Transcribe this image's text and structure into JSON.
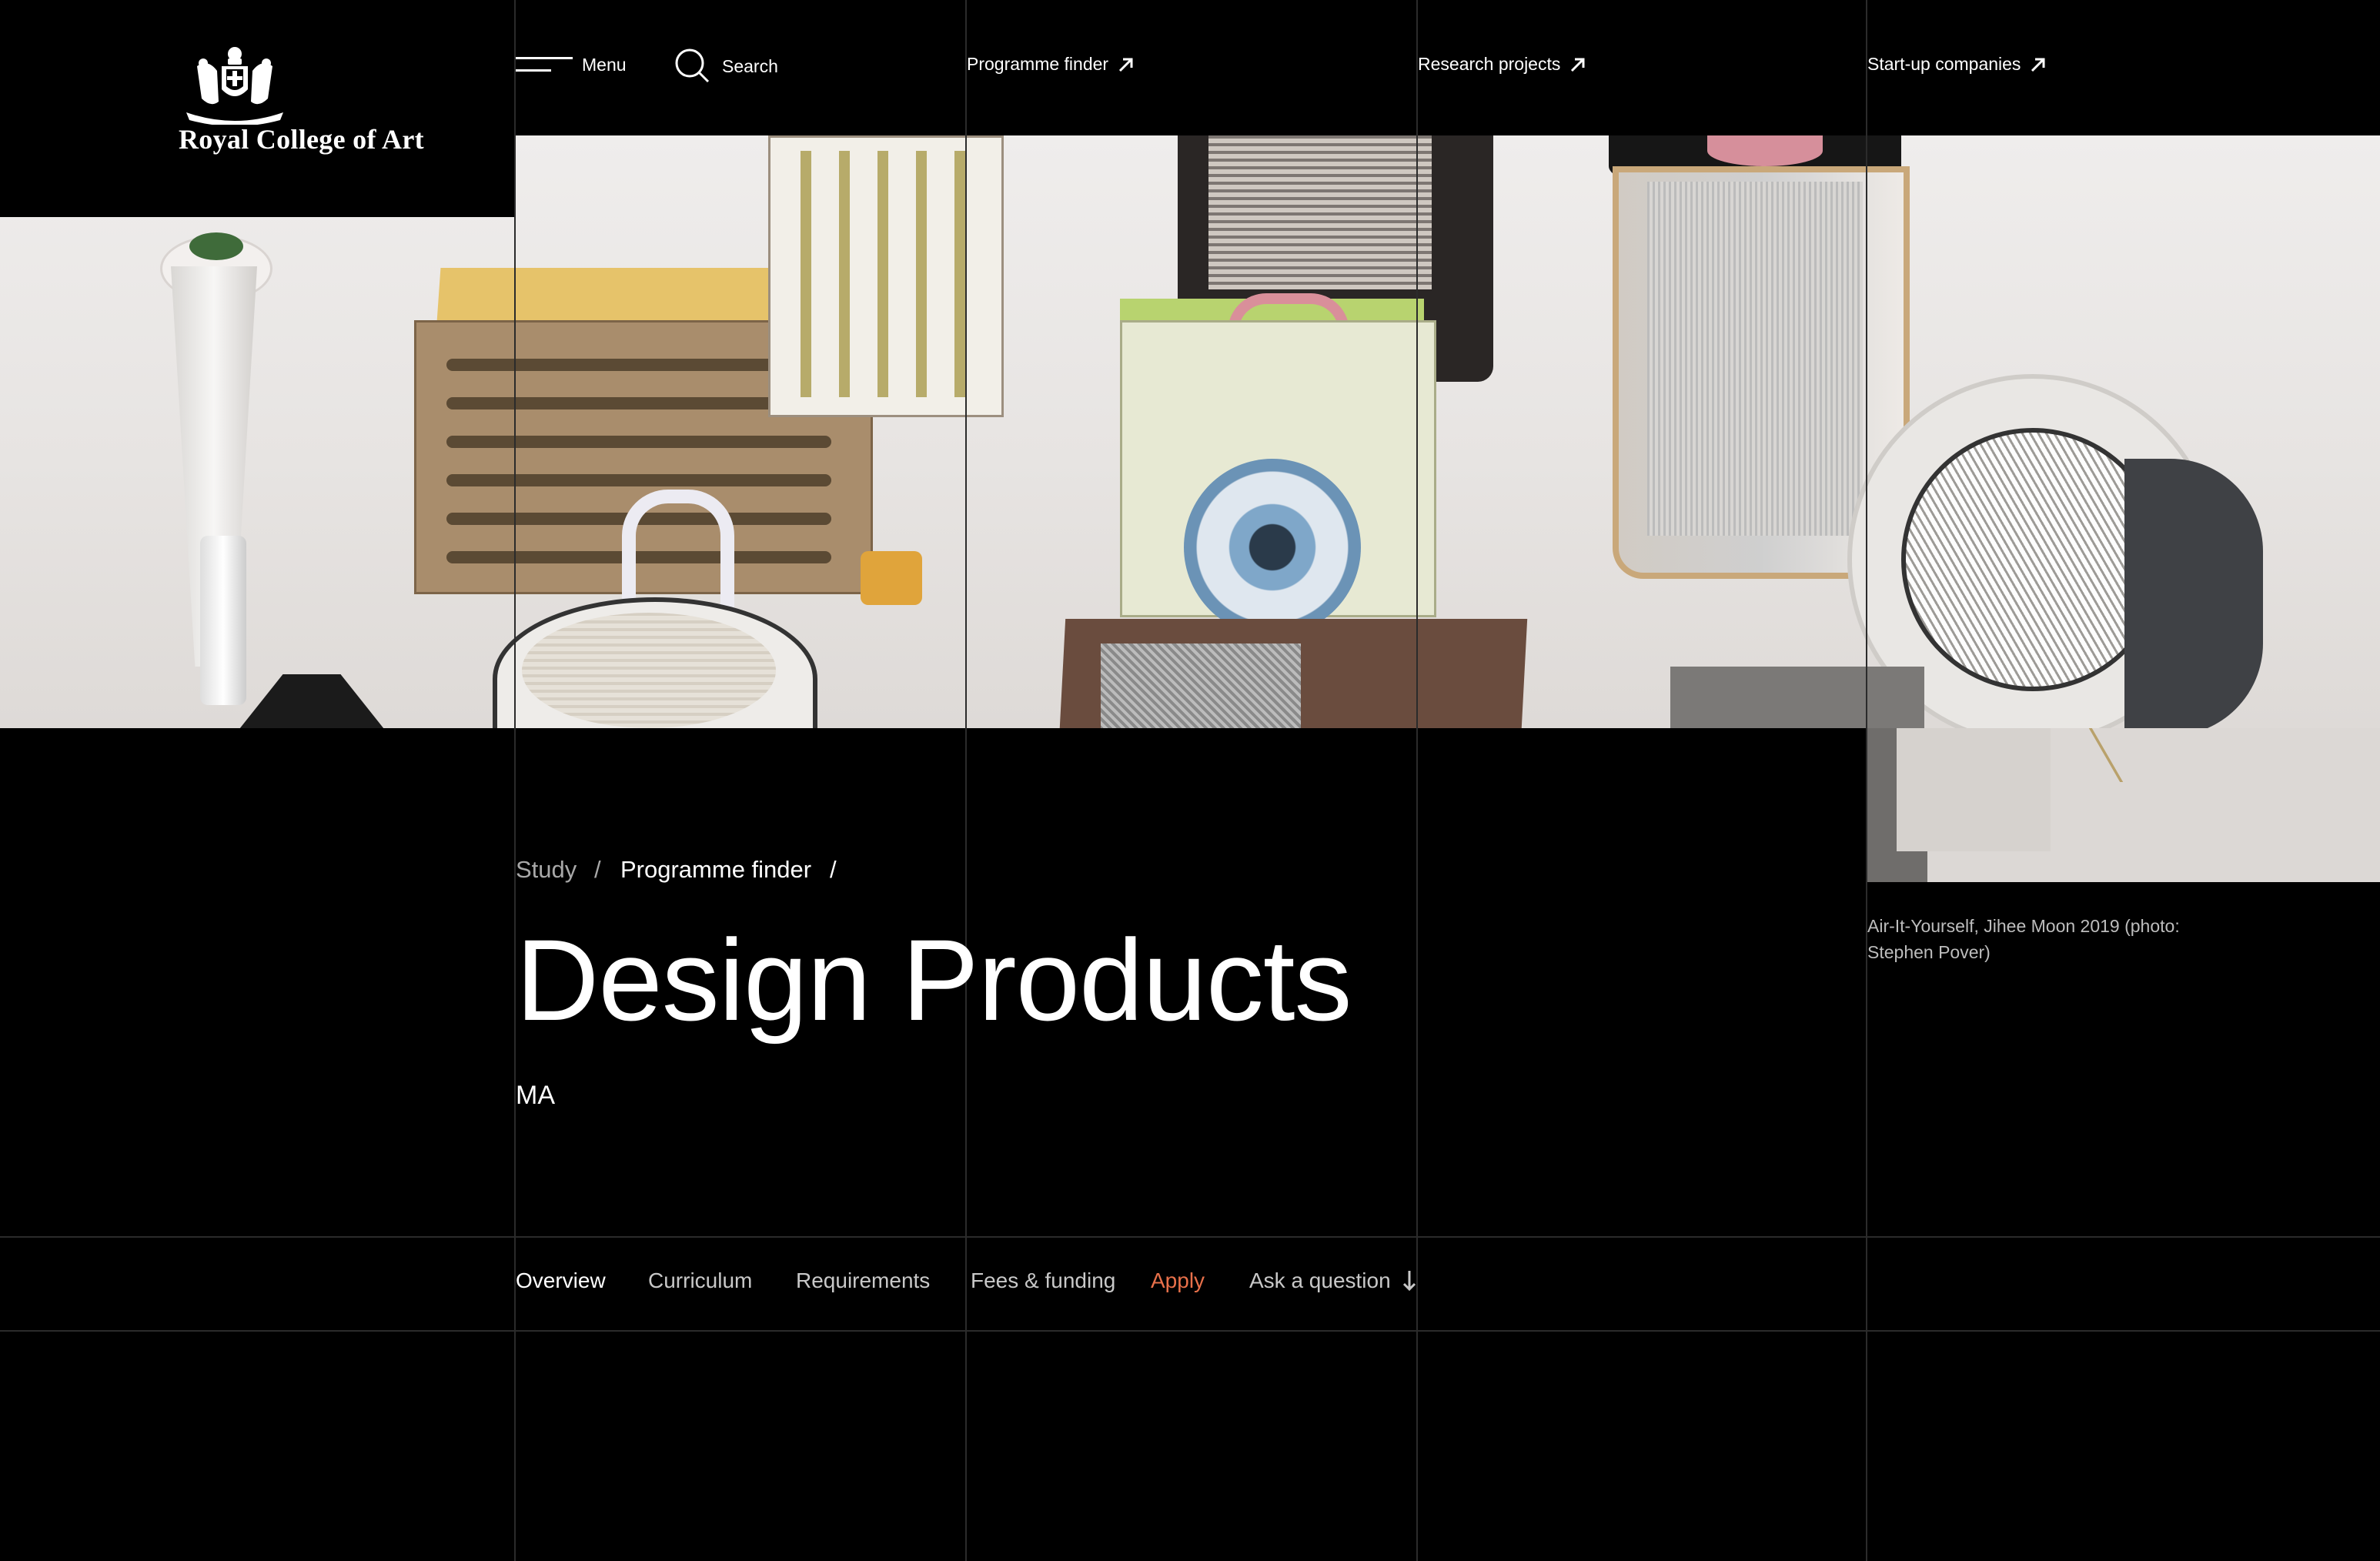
{
  "brand": {
    "name": "Royal College of Art"
  },
  "header": {
    "menu_label": "Menu",
    "search_label": "Search",
    "links": [
      {
        "label": "Programme finder",
        "icon": "external-arrow-icon"
      },
      {
        "label": "Research projects",
        "icon": "external-arrow-icon"
      },
      {
        "label": "Start-up companies",
        "icon": "external-arrow-icon"
      }
    ]
  },
  "hero": {
    "caption": "Air-It-Yourself, Jihee Moon 2019 (photo: Stephen Pover)"
  },
  "breadcrumb": {
    "items": [
      "Study",
      "Programme finder"
    ],
    "separator": "/"
  },
  "page": {
    "title": "Design Products",
    "degree": "MA"
  },
  "tabs": {
    "items": [
      "Overview",
      "Curriculum",
      "Requirements",
      "Fees & funding",
      "Apply",
      "Ask a question"
    ],
    "active": "Overview",
    "ask_icon": "arrow-down-icon"
  },
  "colors": {
    "background": "#000000",
    "text": "#ffffff",
    "accent_apply": "#e8704a",
    "grid": "#2b2b2b"
  }
}
